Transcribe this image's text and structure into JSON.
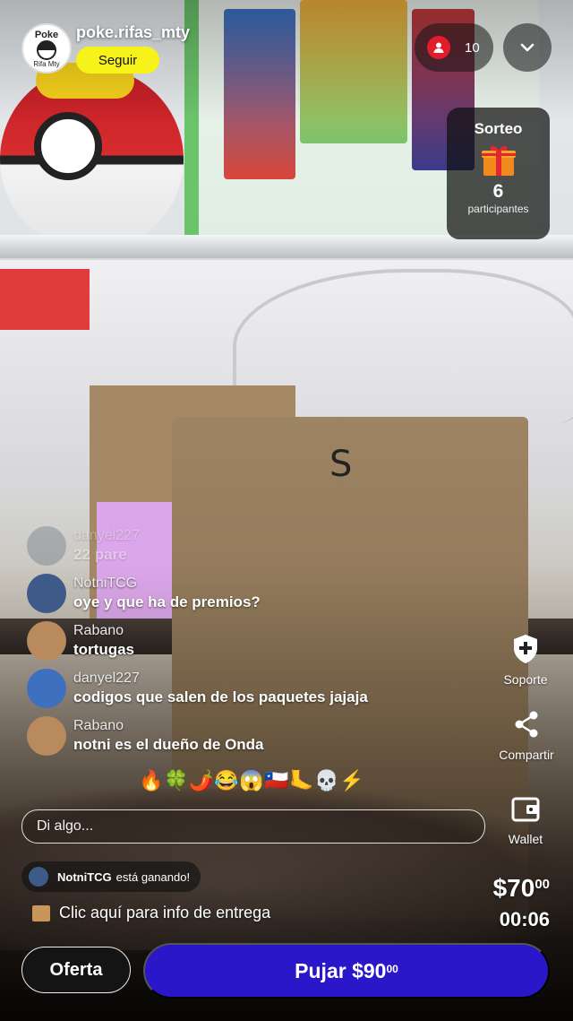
{
  "streamer": {
    "name": "poke.rifas_mty",
    "follow_label": "Seguir",
    "avatar_top_text": "Poke",
    "avatar_bottom_text": "Rifa Mty"
  },
  "viewers": {
    "count": "10",
    "icon": "user-icon"
  },
  "giveaway": {
    "title": "Sorteo",
    "count": "6",
    "label": "participantes",
    "icon": "gift-icon"
  },
  "background_video": {
    "envelope_letter": "S"
  },
  "chat": [
    {
      "user": "danyel227",
      "text": "22 pare",
      "avatar_color": "#5a6a7a",
      "faded": true
    },
    {
      "user": "NotniTCG",
      "text": "oye y que ha de premios?",
      "avatar_color": "#3d5a88"
    },
    {
      "user": "Rabano",
      "text": "tortugas",
      "avatar_color": "#b98a5e"
    },
    {
      "user": "danyel227",
      "text": "codigos que salen de los paquetes jajaja",
      "avatar_color": "#3f6fbf"
    },
    {
      "user": "Rabano",
      "text": "notni es el dueño de Onda",
      "avatar_color": "#b98a5e"
    }
  ],
  "reactions": [
    "🔥",
    "🍀",
    "🌶️",
    "😂",
    "😱",
    "🇨🇱",
    "🦶",
    "💀",
    "⚡"
  ],
  "comment_input": {
    "placeholder": "Di algo..."
  },
  "side_actions": {
    "support": "Soporte",
    "share": "Compartir",
    "wallet": "Wallet"
  },
  "winner_banner": {
    "user": "NotniTCG",
    "text": "está ganando!"
  },
  "delivery_info": "Clic aquí para info de entrega",
  "current_price": {
    "main": "$70",
    "cents": "00"
  },
  "timer": "00:06",
  "offer_button": "Oferta",
  "bid_button": {
    "main": "Pujar $90",
    "cents": "00"
  },
  "colors": {
    "follow": "#f6f21a",
    "bid": "#2a17c9",
    "viewer_badge": "#e11d2a"
  }
}
